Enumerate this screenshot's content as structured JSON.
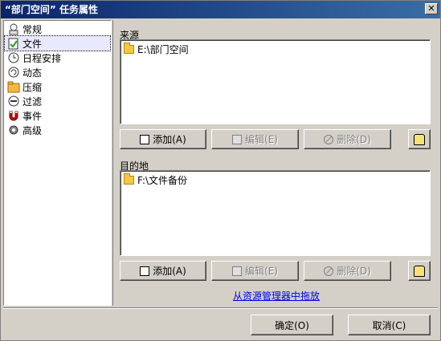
{
  "window": {
    "title": "“部门空间” 任务属性",
    "close_glyph": "✕"
  },
  "sidebar": {
    "items": [
      {
        "label": "常规",
        "icon": "general-icon"
      },
      {
        "label": "文件",
        "icon": "file-icon",
        "selected": true
      },
      {
        "label": "日程安排",
        "icon": "clock-icon"
      },
      {
        "label": "动态",
        "icon": "dynamic-icon"
      },
      {
        "label": "压缩",
        "icon": "archive-icon"
      },
      {
        "label": "过滤",
        "icon": "filter-icon"
      },
      {
        "label": "事件",
        "icon": "magnet-icon"
      },
      {
        "label": "高级",
        "icon": "gear-icon"
      }
    ]
  },
  "source": {
    "label": "来源",
    "items": [
      "E:\\部门空间"
    ],
    "add_label": "添加(A)",
    "edit_label": "编辑(E)",
    "delete_label": "删除(D)"
  },
  "destination": {
    "label": "目的地",
    "items": [
      "F:\\文件备份"
    ],
    "add_label": "添加(A)",
    "edit_label": "编辑(E)",
    "delete_label": "删除(D)"
  },
  "drag_link": "从资源管理器中拖放",
  "footer": {
    "ok_label": "确定(O)",
    "cancel_label": "取消(C)"
  }
}
